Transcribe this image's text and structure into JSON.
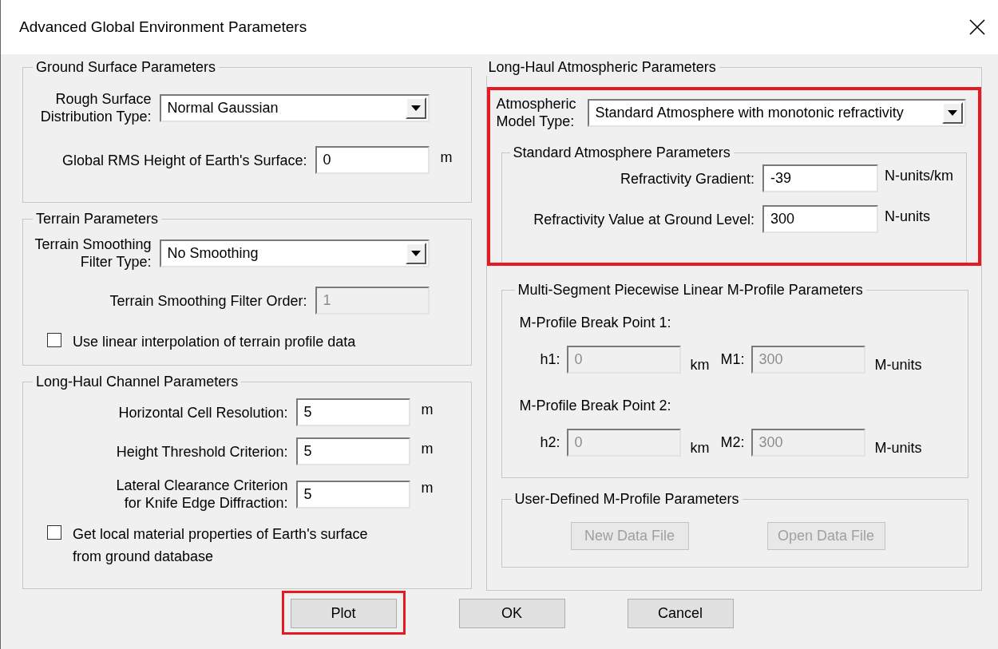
{
  "window": {
    "title": "Advanced Global Environment Parameters"
  },
  "ground_surface": {
    "title": "Ground Surface Parameters",
    "fields": [
      {
        "kind": "dropdown",
        "label": "Rough Surface\nDistribution Type:",
        "value": "Normal Gaussian"
      },
      {
        "kind": "input",
        "label": "Global RMS Height of Earth's Surface:",
        "value": "0",
        "unit": "m",
        "disabled": false
      }
    ]
  },
  "terrain": {
    "title": "Terrain Parameters",
    "fields": [
      {
        "kind": "dropdown",
        "label": "Terrain Smoothing\nFilter Type:",
        "value": "No Smoothing"
      },
      {
        "kind": "input",
        "label": "Terrain Smoothing Filter Order:",
        "value": "1",
        "disabled": true
      },
      {
        "kind": "checkbox",
        "label": "Use linear interpolation of terrain profile data",
        "checked": false
      }
    ]
  },
  "channel": {
    "title": "Long-Haul Channel Parameters",
    "fields": [
      {
        "kind": "input",
        "label": "Horizontal Cell Resolution:",
        "value": "5",
        "unit": "m",
        "disabled": false
      },
      {
        "kind": "input",
        "label": "Height Threshold Criterion:",
        "value": "5",
        "unit": "m",
        "disabled": false
      },
      {
        "kind": "input",
        "label": "Lateral Clearance Criterion\nfor Knife Edge Diffraction:",
        "value": "5",
        "unit": "m",
        "disabled": false
      },
      {
        "kind": "checkbox",
        "label": "Get local material properties of Earth's surface\nfrom ground database",
        "checked": false
      }
    ]
  },
  "atmospheric": {
    "title": "Long-Haul Atmospheric Parameters",
    "highlighted": true,
    "model": {
      "kind": "dropdown",
      "label": "Atmospheric\nModel Type:",
      "value": "Standard Atmosphere with monotonic refractivity"
    },
    "standard": {
      "title": "Standard Atmosphere Parameters",
      "fields": [
        {
          "kind": "input",
          "label": "Refractivity Gradient:",
          "value": "-39",
          "unit": "N-units/km",
          "disabled": false
        },
        {
          "kind": "input",
          "label": "Refractivity Value at Ground Level:",
          "value": "300",
          "unit": "N-units",
          "disabled": false
        }
      ]
    },
    "multi_segment": {
      "title": "Multi-Segment Piecewise Linear M-Profile Parameters",
      "break_points": [
        {
          "title": "M-Profile Break Point 1:",
          "pairs": [
            {
              "label": "h1:",
              "value": "0",
              "unit": "km",
              "disabled": true
            },
            {
              "label": "M1:",
              "value": "300",
              "unit": "M-units",
              "disabled": true
            }
          ]
        },
        {
          "title": "M-Profile Break Point 2:",
          "pairs": [
            {
              "label": "h2:",
              "value": "0",
              "unit": "km",
              "disabled": true
            },
            {
              "label": "M2:",
              "value": "300",
              "unit": "M-units",
              "disabled": true
            }
          ]
        }
      ]
    },
    "user_defined": {
      "title": "User-Defined M-Profile Parameters",
      "buttons": [
        {
          "label": "New Data File",
          "disabled": true
        },
        {
          "label": "Open Data File",
          "disabled": true
        }
      ]
    }
  },
  "buttons": [
    {
      "label": "Plot",
      "highlighted": true
    },
    {
      "label": "OK",
      "highlighted": false
    },
    {
      "label": "Cancel",
      "highlighted": false
    }
  ]
}
